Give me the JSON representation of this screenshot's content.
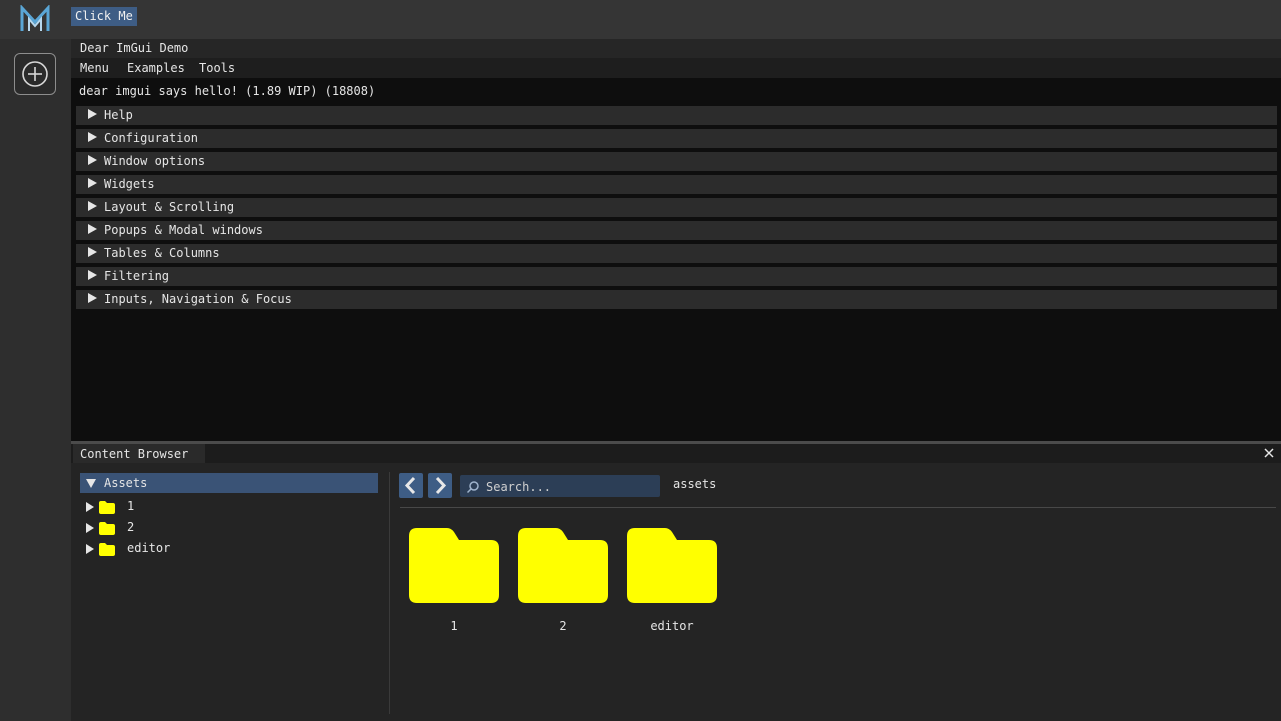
{
  "topbar": {
    "click_me_label": "Click Me"
  },
  "toolbar": {
    "add_icon": "plus-circle-icon"
  },
  "demo_window": {
    "title": "Dear ImGui Demo",
    "menus": [
      "Menu",
      "Examples",
      "Tools"
    ],
    "hello_text": "dear imgui says hello! (1.89 WIP) (18808)",
    "headers": [
      "Help",
      "Configuration",
      "Window options",
      "Widgets",
      "Layout & Scrolling",
      "Popups & Modal windows",
      "Tables & Columns",
      "Filtering",
      "Inputs, Navigation & Focus"
    ]
  },
  "content_browser": {
    "tab_label": "Content Browser",
    "tree": {
      "root_label": "Assets",
      "items": [
        "1",
        "2",
        "editor"
      ]
    },
    "search_placeholder": "Search...",
    "current_path": "assets",
    "folders": [
      "1",
      "2",
      "editor"
    ]
  },
  "colors": {
    "accent_button": "#3e5d85",
    "folder_yellow": "#ffff00",
    "selected_row": "#3a5376"
  }
}
